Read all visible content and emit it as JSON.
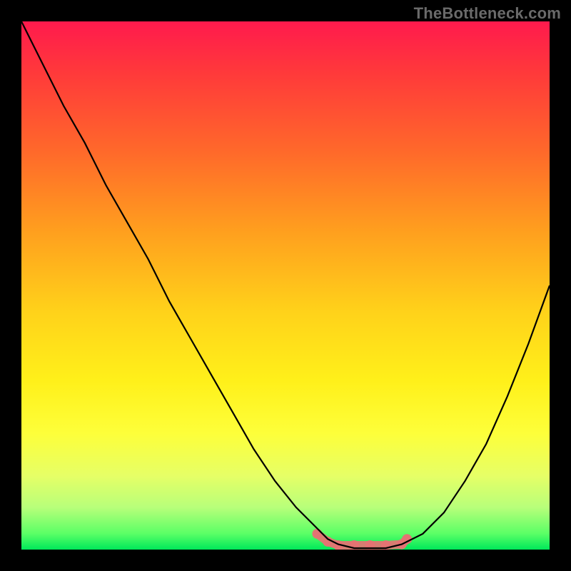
{
  "watermark": "TheBottleneck.com",
  "colors": {
    "highlight": "#e57373",
    "curve": "#000000",
    "background": "#000000"
  },
  "chart_data": {
    "type": "line",
    "title": "",
    "xlabel": "",
    "ylabel": "",
    "xlim": [
      0,
      100
    ],
    "ylim": [
      0,
      100
    ],
    "series": [
      {
        "name": "curve",
        "x": [
          0,
          4,
          8,
          12,
          16,
          20,
          24,
          28,
          32,
          36,
          40,
          44,
          48,
          52,
          56,
          58,
          60,
          63,
          66,
          69,
          72,
          76,
          80,
          84,
          88,
          92,
          96,
          100
        ],
        "y": [
          100,
          92,
          84,
          77,
          69,
          62,
          55,
          47,
          40,
          33,
          26,
          19,
          13,
          8,
          4,
          2,
          1,
          0,
          0,
          0,
          1,
          3,
          7,
          13,
          20,
          29,
          39,
          50
        ]
      }
    ],
    "highlight_range": {
      "x_start": 56,
      "x_end": 73,
      "y": 0
    },
    "highlight_points": [
      {
        "x": 56,
        "y": 3
      },
      {
        "x": 58,
        "y": 1.5
      },
      {
        "x": 60,
        "y": 0.5
      },
      {
        "x": 63,
        "y": 0
      },
      {
        "x": 66,
        "y": 0
      },
      {
        "x": 69,
        "y": 0
      },
      {
        "x": 72,
        "y": 1
      },
      {
        "x": 73,
        "y": 2
      }
    ]
  }
}
